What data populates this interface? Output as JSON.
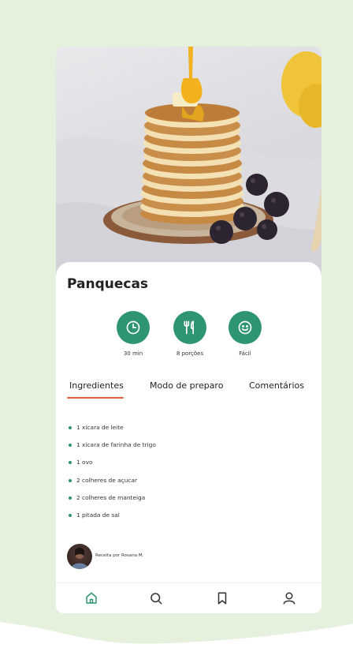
{
  "theme": {
    "accent": "#2e9471",
    "tab_underline": "#e15f3e",
    "background_blob": "#e5f0dd"
  },
  "recipe": {
    "title": "Panquecas",
    "stats": [
      {
        "icon": "clock-icon",
        "label": "30 min"
      },
      {
        "icon": "utensils-icon",
        "label": "8 porções"
      },
      {
        "icon": "smile-icon",
        "label": "Fácil"
      }
    ]
  },
  "tabs": [
    {
      "label": "Ingredientes",
      "active": true
    },
    {
      "label": "Modo de preparo",
      "active": false
    },
    {
      "label": "Comentários",
      "active": false
    }
  ],
  "ingredients": [
    "1 xícara de leite",
    "1 xícara de farinha de trigo",
    "1 ovo",
    "2 colheres de açucar",
    "2 colheres de manteiga",
    "1 pitada de sal"
  ],
  "author": {
    "text": "Receita por Rosana M."
  },
  "nav": [
    {
      "icon": "home-icon",
      "active": true
    },
    {
      "icon": "search-icon",
      "active": false
    },
    {
      "icon": "bookmark-icon",
      "active": false
    },
    {
      "icon": "user-icon",
      "active": false
    }
  ]
}
